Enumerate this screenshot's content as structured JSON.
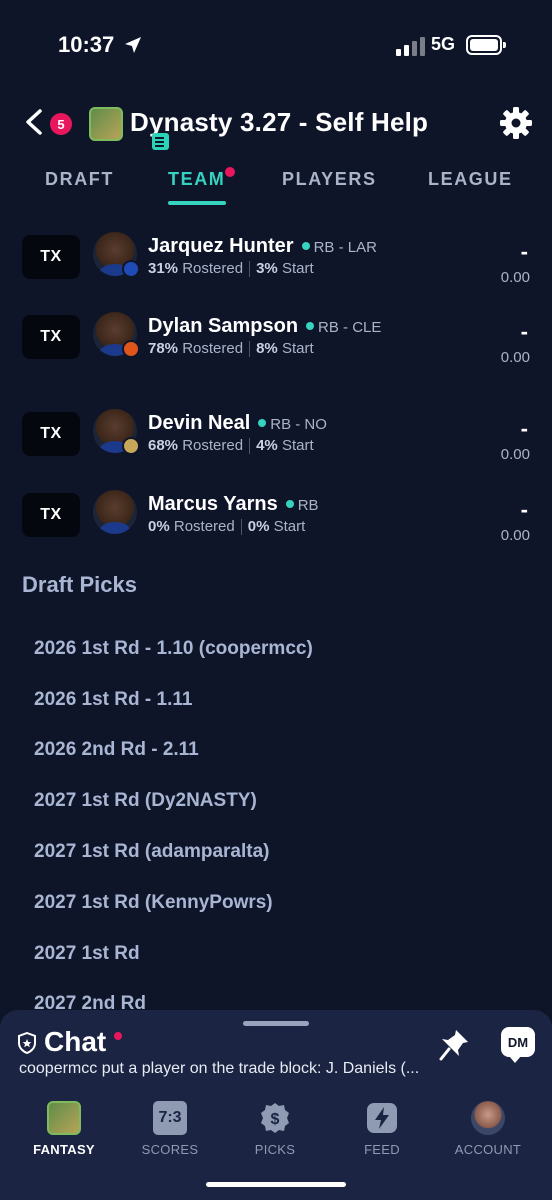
{
  "status_bar": {
    "time": "10:37",
    "network": "5G"
  },
  "header": {
    "badge_count": "5",
    "title": "Dynasty 3.27 - Self Help"
  },
  "tabs": [
    {
      "label": "DRAFT"
    },
    {
      "label": "TEAM"
    },
    {
      "label": "PLAYERS"
    },
    {
      "label": "LEAGUE"
    }
  ],
  "players": [
    {
      "tag": "TX",
      "name": "Jarquez Hunter",
      "pos": "RB - LAR",
      "rostered": "31%",
      "rostered_label": "Rostered",
      "start": "3%",
      "start_label": "Start",
      "dash": "-",
      "score": "0.00",
      "team_color": "#1e4bb5"
    },
    {
      "tag": "TX",
      "name": "Dylan Sampson",
      "pos": "RB - CLE",
      "rostered": "78%",
      "rostered_label": "Rostered",
      "start": "8%",
      "start_label": "Start",
      "dash": "-",
      "score": "0.00",
      "team_color": "#e0551a"
    },
    {
      "tag": "TX",
      "name": "Devin Neal",
      "pos": "RB - NO",
      "rostered": "68%",
      "rostered_label": "Rostered",
      "start": "4%",
      "start_label": "Start",
      "dash": "-",
      "score": "0.00",
      "team_color": "#c7a85a"
    },
    {
      "tag": "TX",
      "name": "Marcus Yarns",
      "pos": "RB",
      "rostered": "0%",
      "rostered_label": "Rostered",
      "start": "0%",
      "start_label": "Start",
      "dash": "-",
      "score": "0.00",
      "team_color": "#cfd6e2"
    }
  ],
  "draft_picks": {
    "title": "Draft Picks",
    "items": [
      "2026 1st Rd - 1.10 (coopermcc)",
      "2026 1st Rd - 1.11",
      "2026 2nd Rd - 2.11",
      "2027 1st Rd (Dy2NASTY)",
      "2027 1st Rd (adamparalta)",
      "2027 1st Rd (KennyPowrs)",
      "2027 1st Rd",
      "2027 2nd Rd"
    ]
  },
  "chat": {
    "title": "Chat",
    "message": "coopermcc put a player on the trade block: J. Daniels (...",
    "dm_label": "DM"
  },
  "nav": [
    {
      "label": "FANTASY",
      "icon": "fantasy-icon"
    },
    {
      "label": "SCORES",
      "icon": "scores-icon",
      "icon_text": "7:3"
    },
    {
      "label": "PICKS",
      "icon": "picks-icon"
    },
    {
      "label": "FEED",
      "icon": "feed-icon"
    },
    {
      "label": "ACCOUNT",
      "icon": "account-icon"
    }
  ],
  "colors": {
    "background": "#0f1529",
    "accent": "#35d3c0",
    "badge": "#e8175d",
    "panel": "#1b2442"
  }
}
